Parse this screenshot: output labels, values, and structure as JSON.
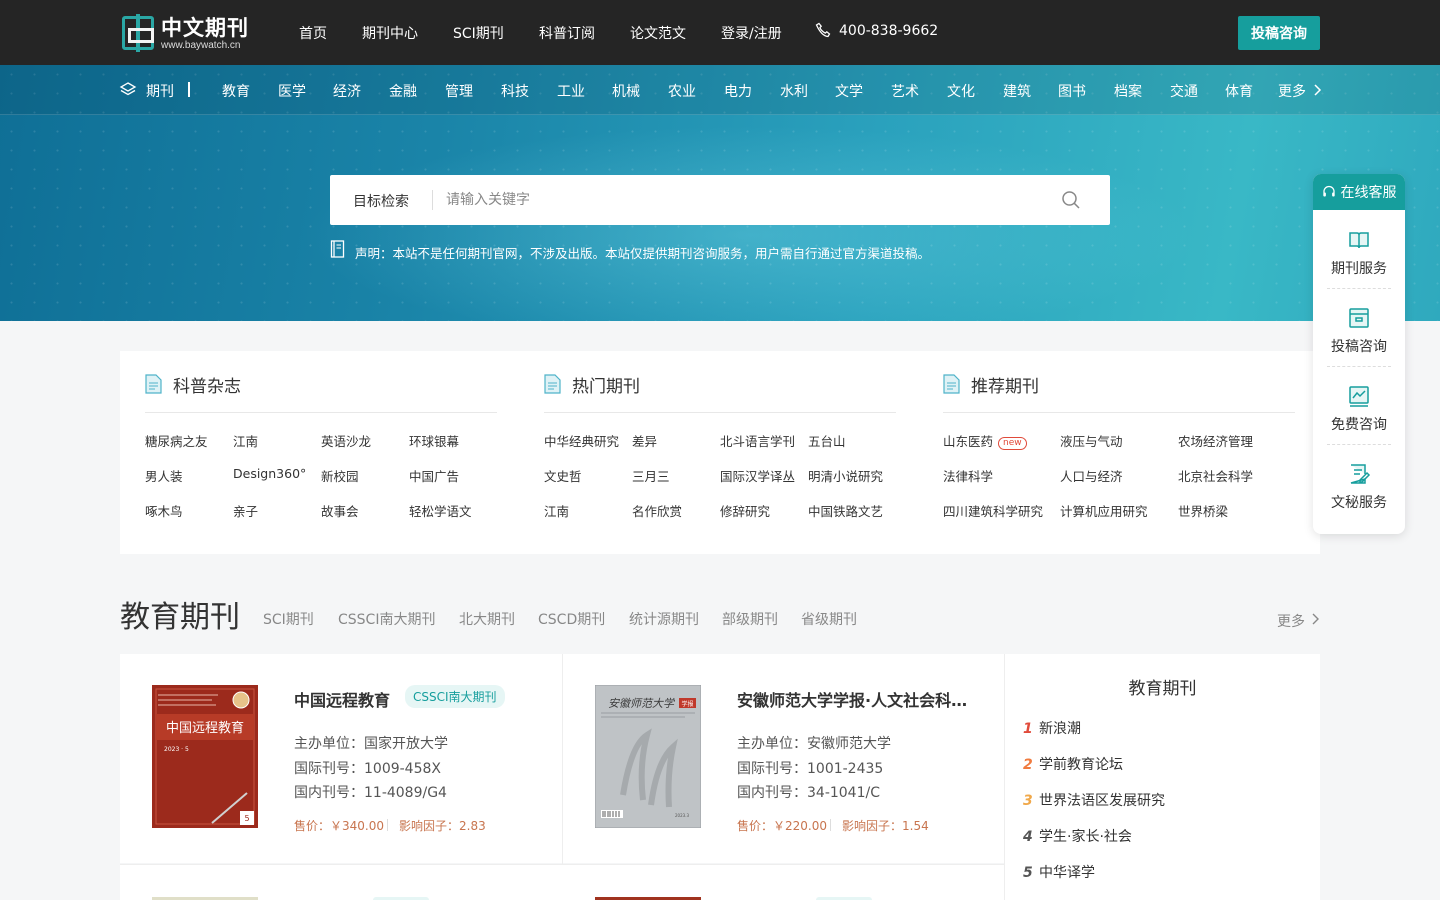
{
  "header": {
    "logo_title": "中文期刊",
    "logo_sub": "www.baywatch.cn",
    "nav": [
      "首页",
      "期刊中心",
      "SCI期刊",
      "科普订阅",
      "论文范文",
      "登录/注册"
    ],
    "phone": "400-838-9662",
    "cta": "投稿咨询"
  },
  "categories": {
    "label": "期刊",
    "items": [
      "教育",
      "医学",
      "经济",
      "金融",
      "管理",
      "科技",
      "工业",
      "机械",
      "农业",
      "电力",
      "水利",
      "文学",
      "艺术",
      "文化",
      "建筑",
      "图书",
      "档案",
      "交通",
      "体育",
      "更多"
    ]
  },
  "search": {
    "scope": "目标检索",
    "placeholder": "请输入关键字"
  },
  "notice": "声明：本站不是任何期刊官网，不涉及出版。本站仅提供期刊咨询服务，用户需自行通过官方渠道投稿。",
  "columns": [
    {
      "title": "科普杂志",
      "links": [
        [
          "糖尿病之友",
          "江南",
          "英语沙龙",
          "环球银幕"
        ],
        [
          "男人装",
          "Design360°",
          "新校园",
          "中国广告"
        ],
        [
          "啄木鸟",
          "亲子",
          "故事会",
          "轻松学语文"
        ]
      ]
    },
    {
      "title": "热门期刊",
      "links": [
        [
          "中华经典研究",
          "差异",
          "北斗语言学刊",
          "五台山"
        ],
        [
          "文史哲",
          "三月三",
          "国际汉学译丛",
          "明清小说研究"
        ],
        [
          "江南",
          "名作欣赏",
          "修辞研究",
          "中国铁路文艺"
        ]
      ]
    },
    {
      "title": "推荐期刊",
      "links": [
        [
          "山东医药",
          "液压与气动",
          "农场经济管理"
        ],
        [
          "法律科学",
          "人口与经济",
          "北京社会科学"
        ],
        [
          "四川建筑科学研究",
          "计算机应用研究",
          "世界桥梁"
        ]
      ],
      "new_badge": "new"
    }
  ],
  "side": {
    "head": "在线客服",
    "items": [
      "期刊服务",
      "投稿咨询",
      "免费咨询",
      "文秘服务"
    ]
  },
  "section": {
    "title": "教育期刊",
    "tabs": [
      "SCI期刊",
      "CSSCI南大期刊",
      "北大期刊",
      "CSCD期刊",
      "统计源期刊",
      "部级期刊",
      "省级期刊"
    ],
    "more": "更多"
  },
  "journals": [
    {
      "title": "中国远程教育",
      "badge": "CSSCI南大期刊",
      "sponsor": "主办单位：国家开放大学",
      "issn": "国际刊号：1009-458X",
      "cn": "国内刊号：11-4089/G4",
      "price": "售价：￥340.00",
      "impact": "影响因子：2.83",
      "cover_text": "中国远程教育",
      "cover_sub": "2023 · 5",
      "cover_color": "#9c2a1c"
    },
    {
      "title": "安徽师范大学学报·人文社会科学版",
      "badge": "",
      "sponsor": "主办单位：安徽师范大学",
      "issn": "国际刊号：1001-2435",
      "cn": "国内刊号：34-1041/C",
      "price": "售价：￥220.00",
      "impact": "影响因子：1.54",
      "cover_text": "安徽师范大学",
      "cover_sub": "学报",
      "cover_color": "#bfc3c6"
    }
  ],
  "ranking": {
    "title": "教育期刊",
    "items": [
      {
        "num": "1",
        "name": "新浪潮",
        "color": "#e14b3b"
      },
      {
        "num": "2",
        "name": "学前教育论坛",
        "color": "#f07b3f"
      },
      {
        "num": "3",
        "name": "世界法语区发展研究",
        "color": "#f0a84a"
      },
      {
        "num": "4",
        "name": "学生·家长·社会",
        "color": "#555555"
      },
      {
        "num": "5",
        "name": "中华译学",
        "color": "#555555"
      }
    ]
  }
}
